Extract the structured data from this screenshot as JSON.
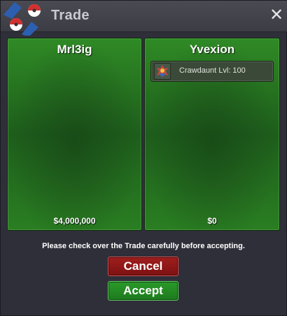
{
  "window": {
    "title": "Trade",
    "close_label": "✕"
  },
  "left_panel": {
    "player_name": "Mrl3ig",
    "money": "$4,000,000",
    "items": []
  },
  "right_panel": {
    "player_name": "Yvexion",
    "money": "$0",
    "items": [
      {
        "label": "Crawdaunt  Lvl: 100",
        "icon": "pokemon-sprite-icon"
      }
    ]
  },
  "notice": "Please check over the Trade carefully before accepting.",
  "buttons": {
    "cancel_label": "Cancel",
    "accept_label": "Accept"
  },
  "colors": {
    "cancel": "#8f1717",
    "accept": "#238a23",
    "panel_green": "#2a7e22"
  }
}
